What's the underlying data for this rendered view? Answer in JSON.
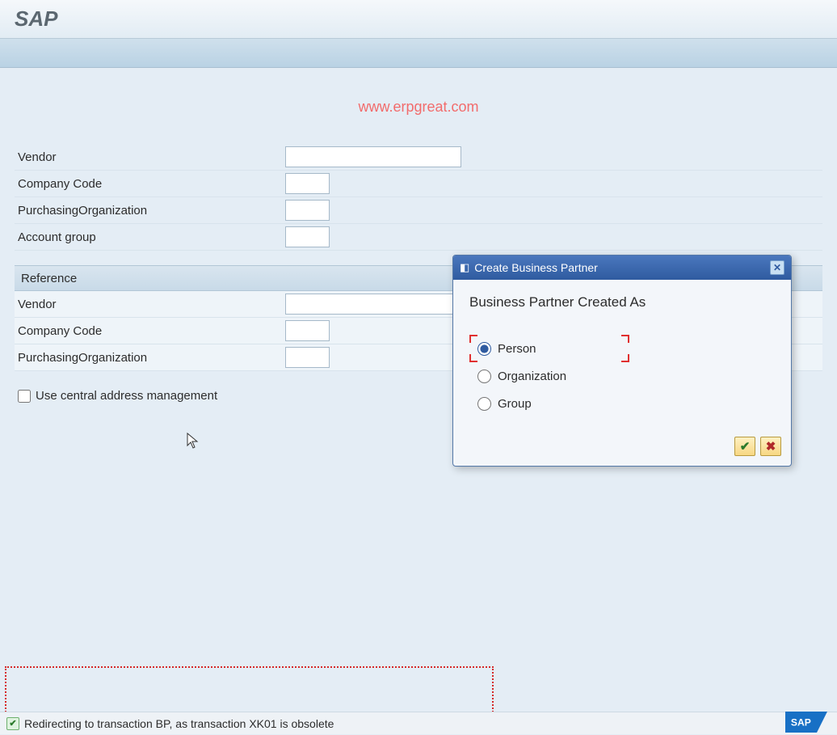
{
  "header": {
    "title": "SAP"
  },
  "watermark": "www.erpgreat.com",
  "form": {
    "vendor_label": "Vendor",
    "vendor_value": "",
    "company_code_label": "Company Code",
    "company_code_value": "",
    "purch_org_label": "PurchasingOrganization",
    "purch_org_value": "",
    "account_group_label": "Account group",
    "account_group_value": ""
  },
  "reference": {
    "section_title": "Reference",
    "vendor_label": "Vendor",
    "vendor_value": "",
    "company_code_label": "Company Code",
    "company_code_value": "",
    "purch_org_label": "PurchasingOrganization",
    "purch_org_value": ""
  },
  "central_address_label": "Use central address management",
  "dialog": {
    "title": "Create Business Partner",
    "heading": "Business Partner Created As",
    "options": {
      "person": "Person",
      "organization": "Organization",
      "group": "Group"
    },
    "selected": "person"
  },
  "status": {
    "message": "Redirecting to transaction BP, as transaction XK01 is obsolete"
  },
  "footer_logo": "SAP"
}
